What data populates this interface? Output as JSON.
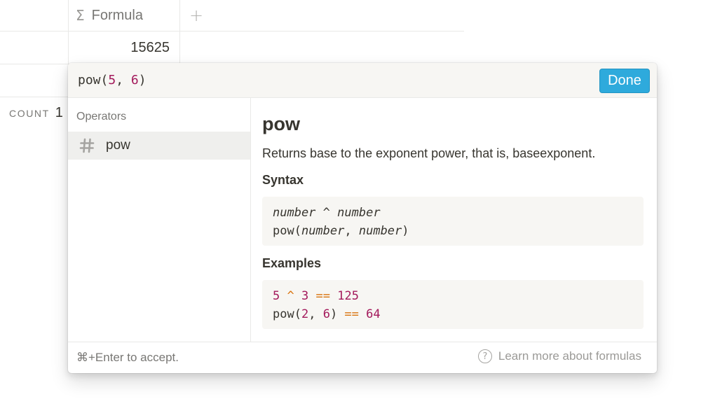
{
  "table": {
    "column_title": "Formula",
    "column_icon": "sigma-icon",
    "add_column_symbol": "+",
    "cell_value": "15625",
    "calc_label": "COUNT",
    "calc_value": "1"
  },
  "formula_editor": {
    "expression_prefix": "pow(",
    "expression_arg1": "5",
    "expression_sep": ", ",
    "expression_arg2": "6",
    "expression_suffix": ")",
    "done_label": "Done",
    "section_label": "Operators",
    "items": [
      {
        "icon": "hash-icon",
        "label": "pow",
        "selected": true
      }
    ],
    "detail": {
      "name": "pow",
      "description": "Returns base to the exponent power, that is, baseexponent.",
      "syntax_heading": "Syntax",
      "syntax_lines": [
        "number ^ number",
        "pow(number, number)"
      ],
      "examples_heading": "Examples",
      "example_lines": [
        "5 ^ 3 == 125",
        "pow(2, 6) == 64"
      ]
    },
    "footer_hint": "⌘+Enter to accept.",
    "learn_more_label": "Learn more about formulas",
    "learn_more_icon": "help-circle-icon"
  },
  "colors": {
    "accent": "#2eaadc",
    "number_token": "#a3195b",
    "operator_token": "#d9730d",
    "text": "#37352f",
    "muted": "#787774"
  }
}
